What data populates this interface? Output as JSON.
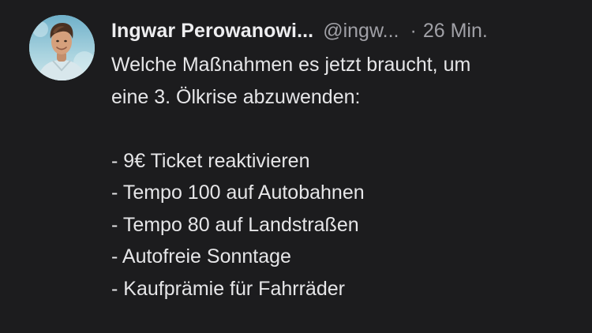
{
  "post": {
    "author_name": "Ingwar Perowanowi...",
    "handle": "@ingw...",
    "separator": "·",
    "time": "26 Min.",
    "avatar_icon": "user-avatar-photo",
    "text_lines": [
      "Welche Maßnahmen es jetzt braucht, um",
      "eine 3. Ölkrise abzuwenden:"
    ],
    "list_items": [
      "- 9€ Ticket reaktivieren",
      "- Tempo 100 auf Autobahnen",
      "- Tempo 80 auf Landstraßen",
      "- Autofreie Sonntage",
      "- Kaufprämie für Fahrräder"
    ]
  },
  "colors": {
    "background": "#1c1c1e",
    "primary_text": "#e9e9eb",
    "secondary_text": "#a0a0a6"
  }
}
